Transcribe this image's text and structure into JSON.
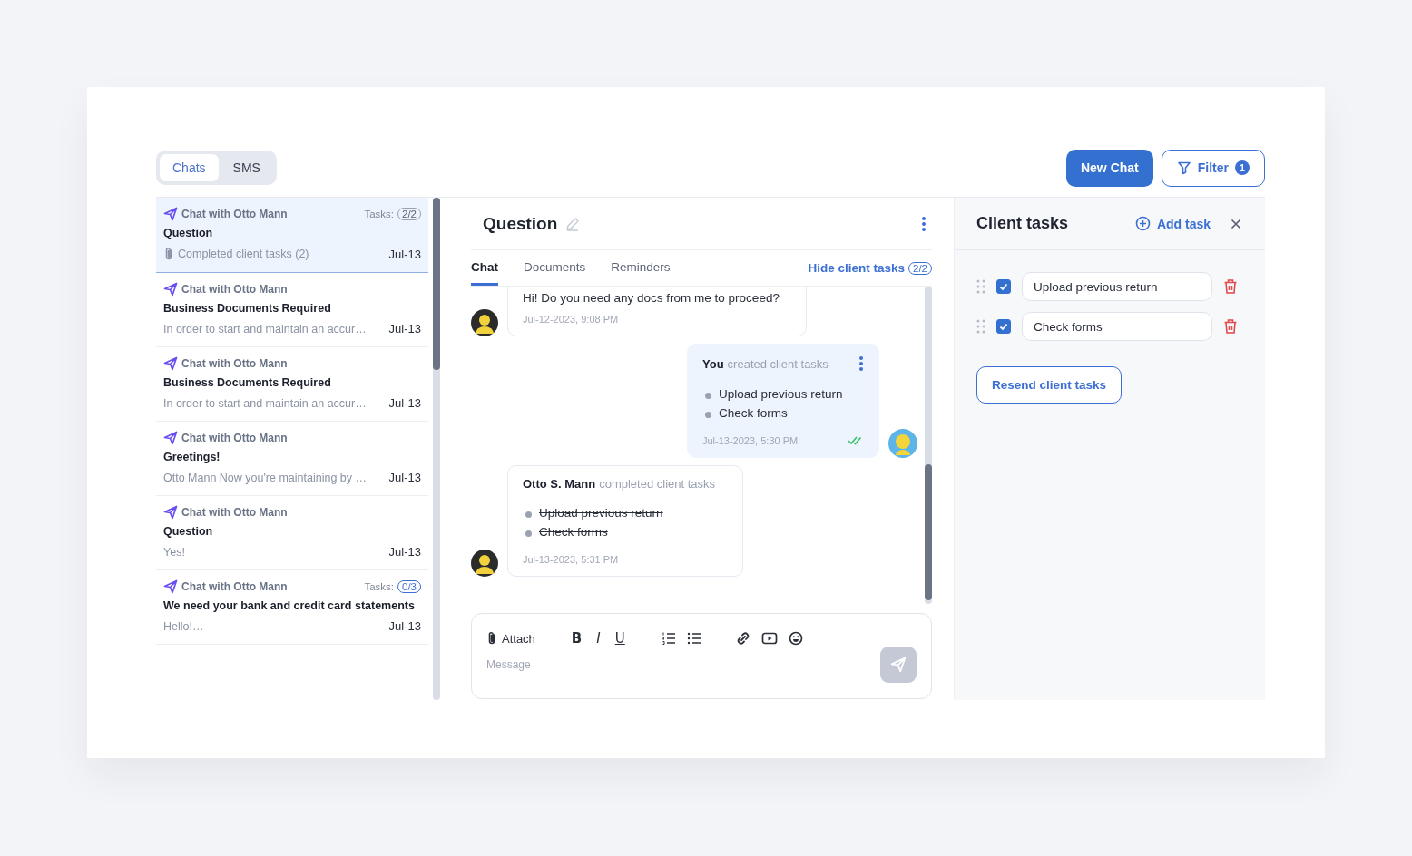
{
  "view_switch": [
    {
      "label": "Chats",
      "selected": true
    },
    {
      "label": "SMS",
      "selected": false
    }
  ],
  "new_chat_button": "New Chat",
  "filter_button": {
    "label": "Filter",
    "count": "1"
  },
  "conversations": [
    {
      "channel": "Chat with Otto Mann",
      "tasks_label": "Tasks:",
      "tasks": "2/2",
      "tasks_done": true,
      "title": "Question",
      "preview": "Completed client tasks (2)",
      "attachment": true,
      "date": "Jul-13",
      "selected": true
    },
    {
      "channel": "Chat with Otto Mann",
      "title": "Business Documents Required",
      "preview": "In order to start and maintain an accur…",
      "attachment": false,
      "date": "Jul-13",
      "selected": false
    },
    {
      "channel": "Chat with Otto Mann",
      "title": "Business Documents Required",
      "preview": "In order to start and maintain an accur…",
      "attachment": false,
      "date": "Jul-13",
      "selected": false
    },
    {
      "channel": "Chat with Otto Mann",
      "title": "Greetings!",
      "preview": "Otto Mann Now you're maintaining by …",
      "attachment": false,
      "date": "Jul-13",
      "selected": false
    },
    {
      "channel": "Chat with Otto Mann",
      "title": "Question",
      "preview": "Yes!",
      "attachment": false,
      "date": "Jul-13",
      "selected": false
    },
    {
      "channel": "Chat with Otto Mann",
      "tasks_label": "Tasks:",
      "tasks": "0/3",
      "tasks_done": false,
      "title": "We need your bank and credit card statements",
      "preview": "Hello!…",
      "attachment": false,
      "date": "Jul-13",
      "selected": false
    }
  ],
  "chat": {
    "title": "Question",
    "tabs": [
      {
        "label": "Chat",
        "selected": true
      },
      {
        "label": "Documents",
        "selected": false
      },
      {
        "label": "Reminders",
        "selected": false
      }
    ],
    "toggle": {
      "label": "Hide client tasks",
      "count": "2/2"
    },
    "messages": [
      {
        "kind": "text",
        "outgoing": false,
        "text": "Hi! Do you need any docs from me to proceed?",
        "time": "Jul-12-2023, 9:08 PM"
      },
      {
        "kind": "tasks",
        "outgoing": true,
        "author": "You",
        "action": "created client tasks",
        "items": [
          {
            "text": "Upload previous return",
            "done": false
          },
          {
            "text": "Check forms",
            "done": false
          }
        ],
        "time": "Jul-13-2023, 5:30 PM",
        "read": true
      },
      {
        "kind": "tasks",
        "outgoing": false,
        "author": "Otto S. Mann",
        "action": "completed client tasks",
        "items": [
          {
            "text": "Upload previous return",
            "done": true
          },
          {
            "text": "Check forms",
            "done": true
          }
        ],
        "time": "Jul-13-2023, 5:31 PM"
      }
    ],
    "composer": {
      "attach": "Attach",
      "format_buttons": [
        "B",
        "I",
        "U"
      ],
      "placeholder": "Message"
    }
  },
  "client_tasks": {
    "title": "Client tasks",
    "add": "Add task",
    "tasks": [
      {
        "value": "Upload previous return",
        "checked": true
      },
      {
        "value": "Check forms",
        "checked": true
      }
    ],
    "resend": "Resend client tasks"
  }
}
